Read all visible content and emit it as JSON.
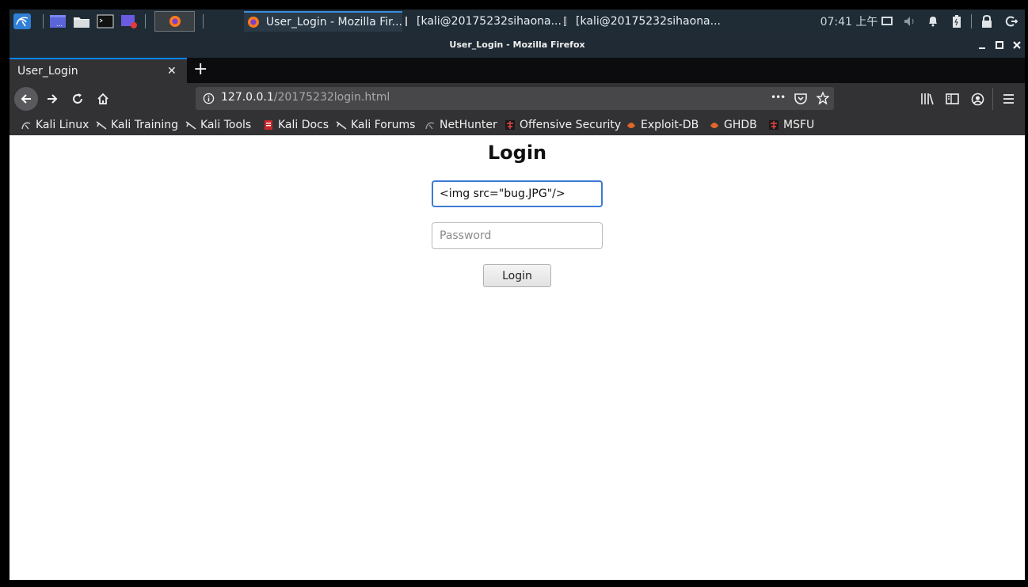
{
  "panel": {
    "tasks": [
      {
        "label": "User_Login - Mozilla Fir..."
      },
      {
        "label": "[kali@20175232sihaona..."
      },
      {
        "label": "[kali@20175232sihaona..."
      }
    ],
    "clock": "07:41 上午"
  },
  "window": {
    "title": "User_Login - Mozilla Firefox"
  },
  "tab": {
    "title": "User_Login",
    "close": "✕",
    "new_tab": "+"
  },
  "urlbar": {
    "host": "127.0.0.1",
    "path": "/20175232login.html",
    "more": "•••"
  },
  "bookmarks": [
    {
      "label": "Kali Linux",
      "icon": "kali-dragon-icon"
    },
    {
      "label": "Kali Training",
      "icon": "kali-dragon-icon"
    },
    {
      "label": "Kali Tools",
      "icon": "kali-dragon-icon"
    },
    {
      "label": "Kali Docs",
      "icon": "docs-icon"
    },
    {
      "label": "Kali Forums",
      "icon": "kali-dragon-icon"
    },
    {
      "label": "NetHunter",
      "icon": "kali-dragon-icon"
    },
    {
      "label": "Offensive Security",
      "icon": "offsec-icon"
    },
    {
      "label": "Exploit-DB",
      "icon": "exploit-db-icon"
    },
    {
      "label": "GHDB",
      "icon": "exploit-db-icon"
    },
    {
      "label": "MSFU",
      "icon": "offsec-icon"
    }
  ],
  "page": {
    "heading": "Login",
    "username_value": "<img src=\"bug.JPG\"/>",
    "password_placeholder": "Password",
    "login_button": "Login"
  },
  "colors": {
    "accent": "#0a84ff",
    "panel": "#1f2c36",
    "toolbar": "#323234",
    "focus_border": "#3b7bd4"
  }
}
